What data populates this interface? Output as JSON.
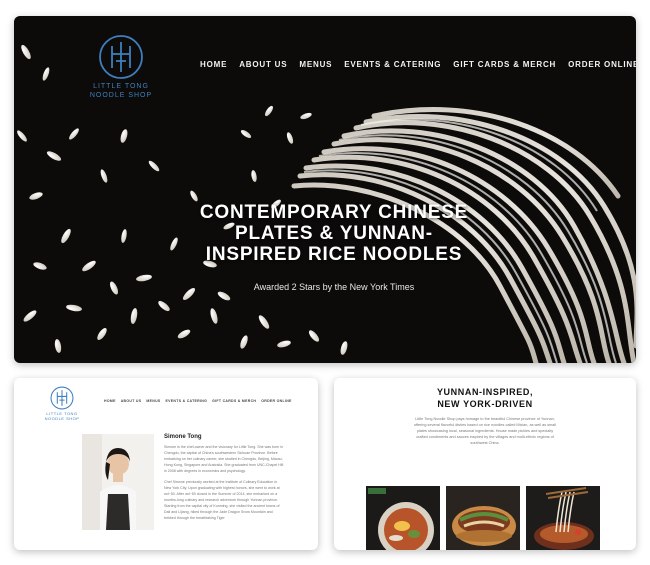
{
  "hero": {
    "logo_text_line1": "LITTLE TONG",
    "logo_text_line2": "NOODLE SHOP",
    "nav": [
      "HOME",
      "ABOUT US",
      "MENUS",
      "EVENTS & CATERING",
      "GIFT CARDS & MERCH",
      "ORDER ONLINE"
    ],
    "headline": "CONTEMPORARY CHINESE\nPLATES & YUNNAN-\nINSPIRED RICE NOODLES",
    "subheadline": "Awarded 2 Stars by the New York Times"
  },
  "about": {
    "logo_text_line1": "LITTLE TONG",
    "logo_text_line2": "NOODLE SHOP",
    "nav": [
      "HOME",
      "ABOUT US",
      "MENUS",
      "EVENTS & CATERING",
      "GIFT CARDS & MERCH",
      "ORDER ONLINE"
    ],
    "name": "Simone Tong",
    "bio_1": "Simone is the chef-owner and the visionary for Little Tong. She was born in Chengdu, the capital of China's southwestern Sichuan Province. Before embarking on her culinary career, she studied in Chengdu, Beijing, Macau, Hong Kong, Singapore and Australia. She graduated from UNC-Chapel Hill in 2008 with degrees in economics and psychology.",
    "bio_2": "Chef Simone previously worked at the Institute of Culinary Education in New York City. Upon graduating with highest honors, she went to work at wd~50. After wd~50 closed in the Summer of 2014, she embarked on a months-long culinary and research adventure through Yunnan province. Starting from the capital city of Kunming, she visited the ancient towns of Dali and Lijiang, hiked through the Jade Dragon Snow Mountain and trekked through the breathtaking Tiger"
  },
  "intro": {
    "title": "YUNNAN-INSPIRED,\nNEW YORK-DRIVEN",
    "text": "Little Tong Noodle Shop pays homage to the beautiful Chinese province of Yunnan, offering several flavorful dishes based on rice noodles called Mixian, as well as small plates showcasing local, seasonal ingredients. House made pickles and specialty crafted condiments and sauces inspired by the villages and multi-ethnic regions of southwest China."
  },
  "colors": {
    "brand_blue": "#3e7fbf",
    "hero_background": "#0c0b0a",
    "noodle_white": "#f1ede6"
  }
}
